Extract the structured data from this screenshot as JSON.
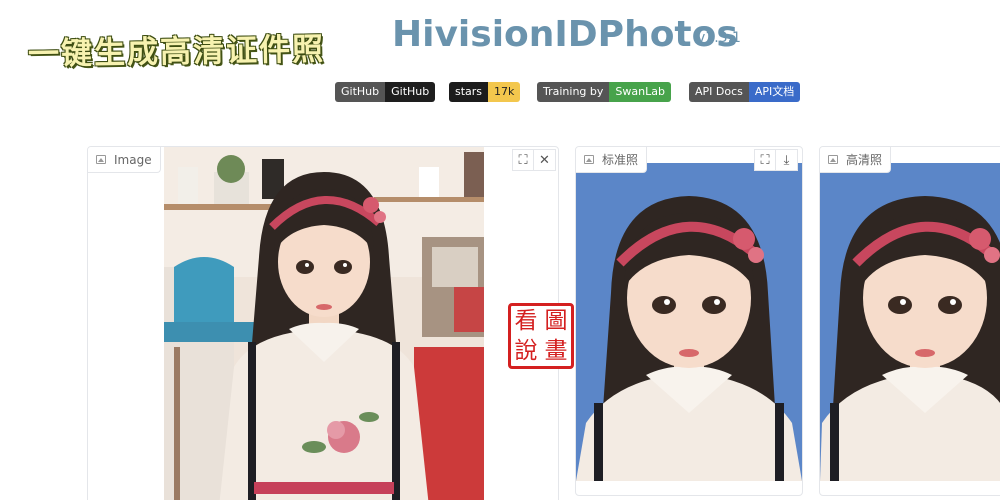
{
  "header": {
    "slogan": "一键生成高清证件照",
    "title": "HivisionIDPhotos",
    "version": "v1.3.1"
  },
  "badges": [
    {
      "left": "GitHub",
      "right": "GitHub"
    },
    {
      "left": "stars",
      "right": "17k"
    },
    {
      "left": "Training by",
      "right": "SwanLab"
    },
    {
      "left": "API Docs",
      "right": "API文档"
    }
  ],
  "panels": {
    "input": {
      "label": "Image",
      "background": "#f3ede6"
    },
    "standard": {
      "label": "标准照",
      "background": "#5b86c8"
    },
    "hd": {
      "label": "高清照",
      "background": "#5b86c8"
    }
  },
  "tool_icons": {
    "fullscreen": "⛶",
    "close": "✕",
    "download": "⤓"
  },
  "seal": {
    "chars": [
      "圖",
      "看",
      "畫",
      "說"
    ]
  },
  "colors": {
    "title": "#6a93ad",
    "id_background": "#5b86c8",
    "seal": "#d42020"
  }
}
